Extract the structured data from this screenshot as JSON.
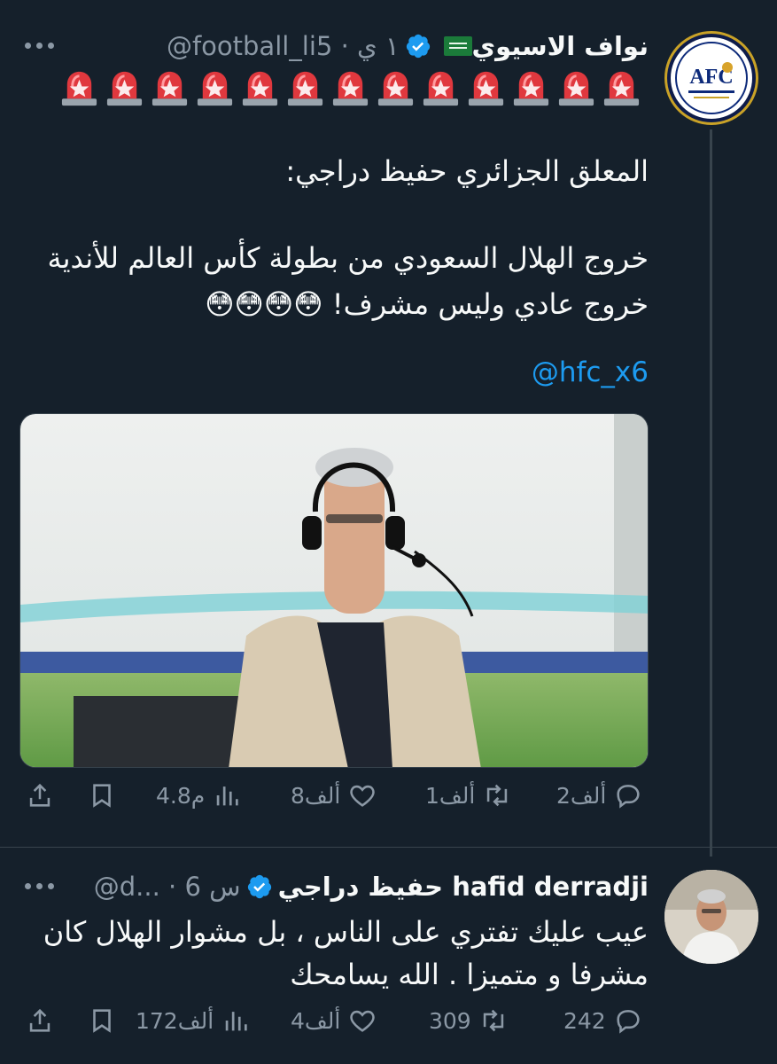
{
  "tweet1": {
    "author_name": "نواف الاسيوي",
    "handle_time": "@football_li5 · ١ ي",
    "lines": [
      "المعلق الجزائري حفيظ دراجي:",
      "خروج الهلال السعودي من بطولة كأس العالم للأندية",
      "خروج عادي وليس مشرف! 😳😳😳😳"
    ],
    "mention": "@hfc_x6",
    "siren_count": 13,
    "stats": {
      "replies": "2ألف",
      "retweets": "1ألف",
      "likes": "8ألف",
      "views": "4.8م"
    }
  },
  "tweet2": {
    "author_name": "حفيظ دراجي hafid derradji",
    "handle_time": "@d... · 6 س",
    "lines": [
      "عيب عليك تفتري على الناس ، بل مشوار الهلال كان",
      "مشرفا و متميزا . الله يسامحك"
    ],
    "stats": {
      "replies": "242",
      "retweets": "309",
      "likes": "4ألف",
      "views": "172ألف"
    }
  },
  "colors": {
    "background": "#15202b",
    "secondary": "#8b98a5",
    "link": "#1d9bf0",
    "verified": "#1d9bf0",
    "divider": "#38444d"
  },
  "icons": [
    "more-icon",
    "verified-badge-icon",
    "saudi-flag-icon",
    "siren-icon",
    "reply-icon",
    "retweet-icon",
    "like-icon",
    "views-icon",
    "bookmark-icon",
    "share-icon"
  ]
}
